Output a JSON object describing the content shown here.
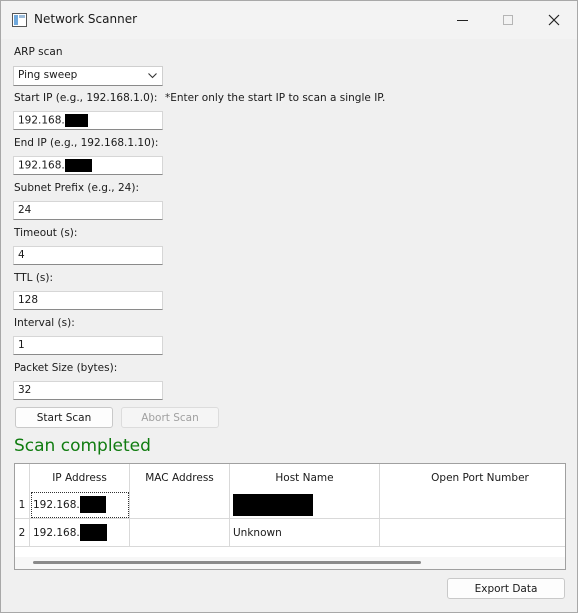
{
  "window": {
    "title": "Network Scanner"
  },
  "icons": {
    "app": "app-window-icon",
    "minimize": "minimize-icon",
    "maximize": "maximize-icon",
    "close": "close-icon",
    "dropdown": "chevron-down-icon"
  },
  "form": {
    "scan_type_label": "ARP scan",
    "scan_type_value": "Ping sweep",
    "start_ip_label": "Start IP (e.g., 192.168.1.0):",
    "start_ip_value": "192.168.",
    "note": "*Enter only the start IP to scan a single IP.",
    "end_ip_label": "End IP (e.g., 192.168.1.10):",
    "end_ip_value": "192.168.",
    "subnet_label": "Subnet Prefix (e.g., 24):",
    "subnet_value": "24",
    "timeout_label": "Timeout (s):",
    "timeout_value": "4",
    "ttl_label": "TTL (s):",
    "ttl_value": "128",
    "interval_label": "Interval (s):",
    "interval_value": "1",
    "packet_label": "Packet Size (bytes):",
    "packet_value": "32"
  },
  "buttons": {
    "start": "Start Scan",
    "abort": "Abort Scan",
    "export": "Export Data"
  },
  "status": {
    "text": "Scan completed",
    "color": "#107c10"
  },
  "table": {
    "headers": [
      "IP Address",
      "MAC Address",
      "Host Name",
      "Open Port Number"
    ],
    "rows": [
      {
        "num": "1",
        "ip": "192.168.",
        "mac": "",
        "host": "",
        "ports": ""
      },
      {
        "num": "2",
        "ip": "192.168.",
        "mac": "",
        "host": "Unknown",
        "ports": ""
      }
    ]
  }
}
